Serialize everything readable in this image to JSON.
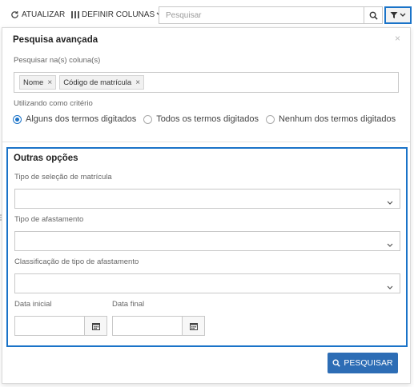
{
  "toolbar": {
    "refresh_label": "ATUALIZAR",
    "columns_label": "DEFINIR COLUNAS",
    "search_placeholder": "Pesquisar"
  },
  "advanced": {
    "title": "Pesquisa avançada",
    "close_glyph": "×",
    "columns_label": "Pesquisar na(s) coluna(s)",
    "tags": [
      "Nome",
      "Código de matrícula"
    ],
    "tag_remove_glyph": "×",
    "criteria_label": "Utilizando como critério",
    "criteria_options": [
      "Alguns dos termos digitados",
      "Todos os termos digitados",
      "Nenhum dos termos digitados"
    ],
    "criteria_selected": "Alguns dos termos digitados"
  },
  "other_options": {
    "title": "Outras opções",
    "enrollment_type_label": "Tipo de seleção de matrícula",
    "leave_type_label": "Tipo de afastamento",
    "leave_class_label": "Classificação de tipo de afastamento",
    "start_date_label": "Data inicial",
    "end_date_label": "Data final"
  },
  "actions": {
    "search_label": "PESQUISAR"
  },
  "colors": {
    "accent": "#1a73c8",
    "primary_button": "#2d6db5"
  },
  "icons": {
    "refresh": "refresh-icon",
    "columns": "columns-icon",
    "search": "search-icon",
    "filter": "filter-icon",
    "calendar": "calendar-icon",
    "chevron": "chevron-down-icon"
  }
}
